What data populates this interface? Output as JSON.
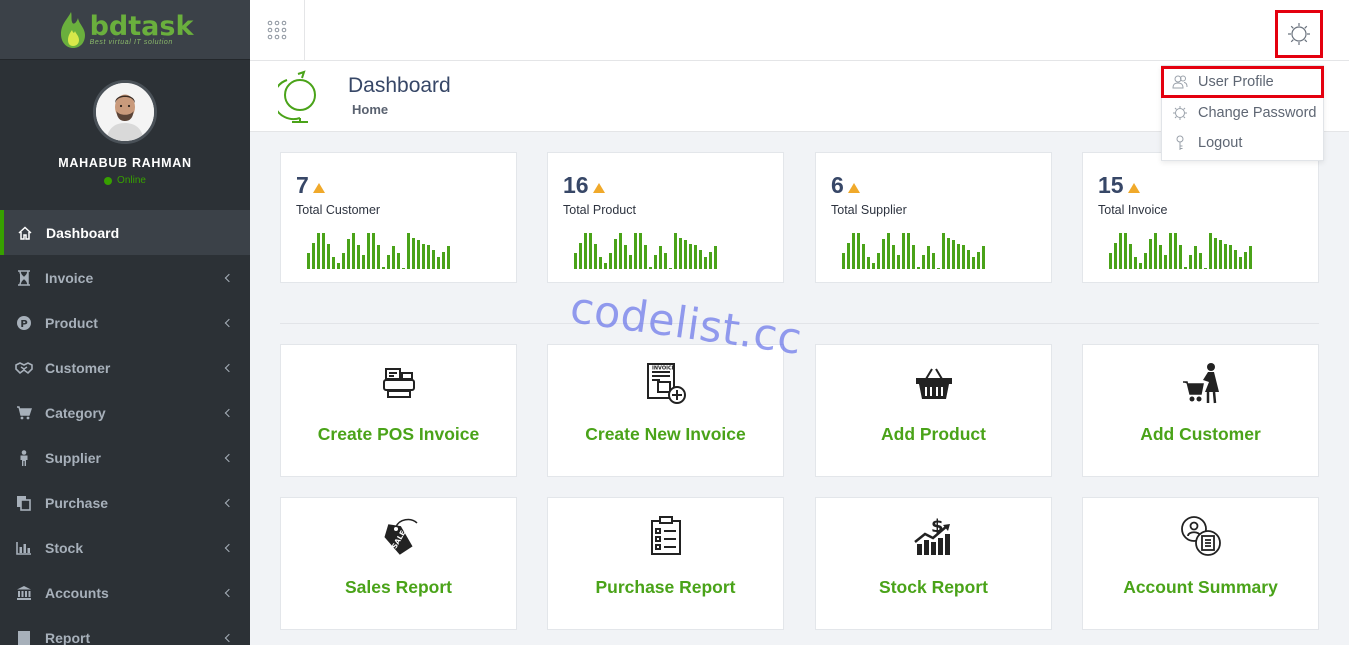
{
  "brand": {
    "name": "bdtask",
    "tagline": "Best virtual IT solution"
  },
  "user": {
    "name": "MAHABUB RAHMAN",
    "status": "Online"
  },
  "sidebar": {
    "items": [
      {
        "label": "Dashboard",
        "icon": "home-icon",
        "active": true
      },
      {
        "label": "Invoice",
        "icon": "hourglass-icon"
      },
      {
        "label": "Product",
        "icon": "product-p-icon"
      },
      {
        "label": "Customer",
        "icon": "handshake-icon"
      },
      {
        "label": "Category",
        "icon": "cart-icon"
      },
      {
        "label": "Supplier",
        "icon": "person-icon"
      },
      {
        "label": "Purchase",
        "icon": "copy-icon"
      },
      {
        "label": "Stock",
        "icon": "bar-chart-icon"
      },
      {
        "label": "Accounts",
        "icon": "bank-icon"
      },
      {
        "label": "Report",
        "icon": "report-icon"
      }
    ]
  },
  "header": {
    "title": "Dashboard",
    "breadcrumb": "Home"
  },
  "dropdown": {
    "items": [
      {
        "label": "User Profile",
        "icon": "users-icon"
      },
      {
        "label": "Change Password",
        "icon": "gear-icon"
      },
      {
        "label": "Logout",
        "icon": "key-icon"
      }
    ]
  },
  "stats": [
    {
      "value": "7",
      "label": "Total Customer"
    },
    {
      "value": "16",
      "label": "Total Product"
    },
    {
      "value": "6",
      "label": "Total Supplier"
    },
    {
      "value": "15",
      "label": "Total Invoice"
    }
  ],
  "sparkline": [
    16,
    25,
    35,
    35,
    24,
    12,
    6,
    16,
    29,
    35,
    23,
    14,
    35,
    35,
    23,
    2,
    14,
    22,
    16,
    1,
    35,
    30,
    28,
    24,
    23,
    18,
    12,
    17,
    22
  ],
  "tiles": [
    {
      "label": "Create POS Invoice",
      "icon": "pos-printer-icon"
    },
    {
      "label": "Create New Invoice",
      "icon": "invoice-add-icon"
    },
    {
      "label": "Add Product",
      "icon": "basket-icon"
    },
    {
      "label": "Add Customer",
      "icon": "shopper-cart-icon"
    },
    {
      "label": "Sales Report",
      "icon": "sale-tag-icon"
    },
    {
      "label": "Purchase Report",
      "icon": "clipboard-checklist-icon"
    },
    {
      "label": "Stock Report",
      "icon": "stock-growth-icon"
    },
    {
      "label": "Account Summary",
      "icon": "account-summary-icon"
    }
  ],
  "watermark": "codelist.cc",
  "colors": {
    "accent": "#4aa319",
    "sidebar": "#2c3136",
    "highlight": "#e4000f",
    "trend": "#f0a92a"
  }
}
